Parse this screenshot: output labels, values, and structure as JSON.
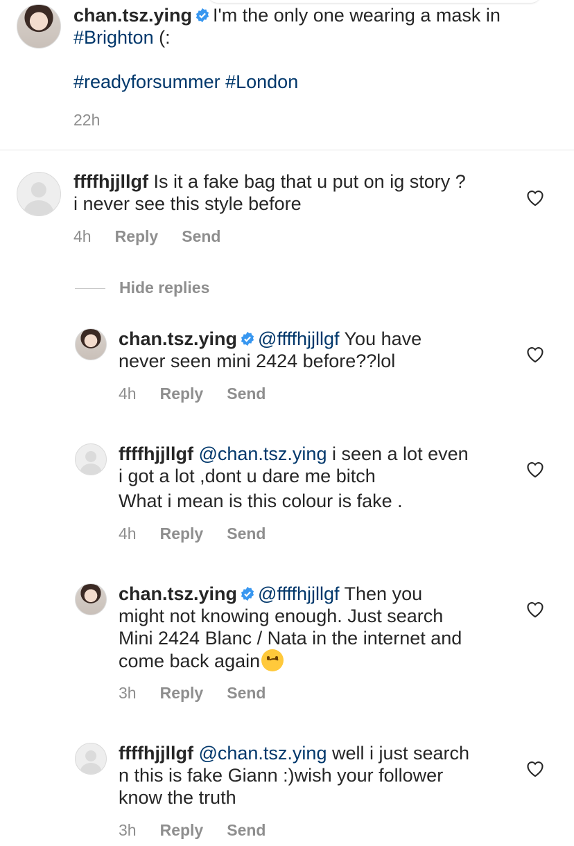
{
  "post": {
    "username": "chan.tsz.ying",
    "caption_line1": "I'm the only one wearing a mask in",
    "tag1": "#Brighton",
    "caption_end": "(:",
    "tag2": "#readyforsummer",
    "tag3": "#London",
    "time": "22h"
  },
  "comment": {
    "username": "ffffhjjllgf",
    "text_line1": "Is it a fake bag that u put on ig story ?",
    "text_line2": "i never see this style before",
    "time": "4h",
    "reply_label": "Reply",
    "send_label": "Send"
  },
  "hide_replies_label": "Hide replies",
  "replies": [
    {
      "username": "chan.tsz.ying",
      "mention": "@ffffhjjllgf",
      "line1": "You have",
      "line2": "never seen mini 2424 before??lol",
      "time": "4h",
      "reply_label": "Reply",
      "send_label": "Send"
    },
    {
      "username": "ffffhjjllgf",
      "mention": "@chan.tsz.ying",
      "line1": "i seen a lot even",
      "line2": "i got a lot ,dont u dare me bitch",
      "line3": "What i mean is this colour is fake .",
      "time": "4h",
      "reply_label": "Reply",
      "send_label": "Send"
    },
    {
      "username": "chan.tsz.ying",
      "mention": "@ffffhjjllgf",
      "line1": "Then you",
      "line2": "might not knowing enough. Just search",
      "line3": "Mini 2424 Blanc / Nata in the internet and",
      "line4": "come back again",
      "emoji": "upside-down-face",
      "time": "3h",
      "reply_label": "Reply",
      "send_label": "Send"
    },
    {
      "username": "ffffhjjllgf",
      "mention": "@chan.tsz.ying",
      "line1": "well i just search",
      "line2": "n this is fake Giann :)wish your follower",
      "line3": "know the truth",
      "time": "3h",
      "reply_label": "Reply",
      "send_label": "Send"
    }
  ],
  "colors": {
    "text": "#262626",
    "secondary": "#8e8e8e",
    "link": "#00376b",
    "verified": "#3897f0",
    "divider": "#e4e4e4"
  }
}
